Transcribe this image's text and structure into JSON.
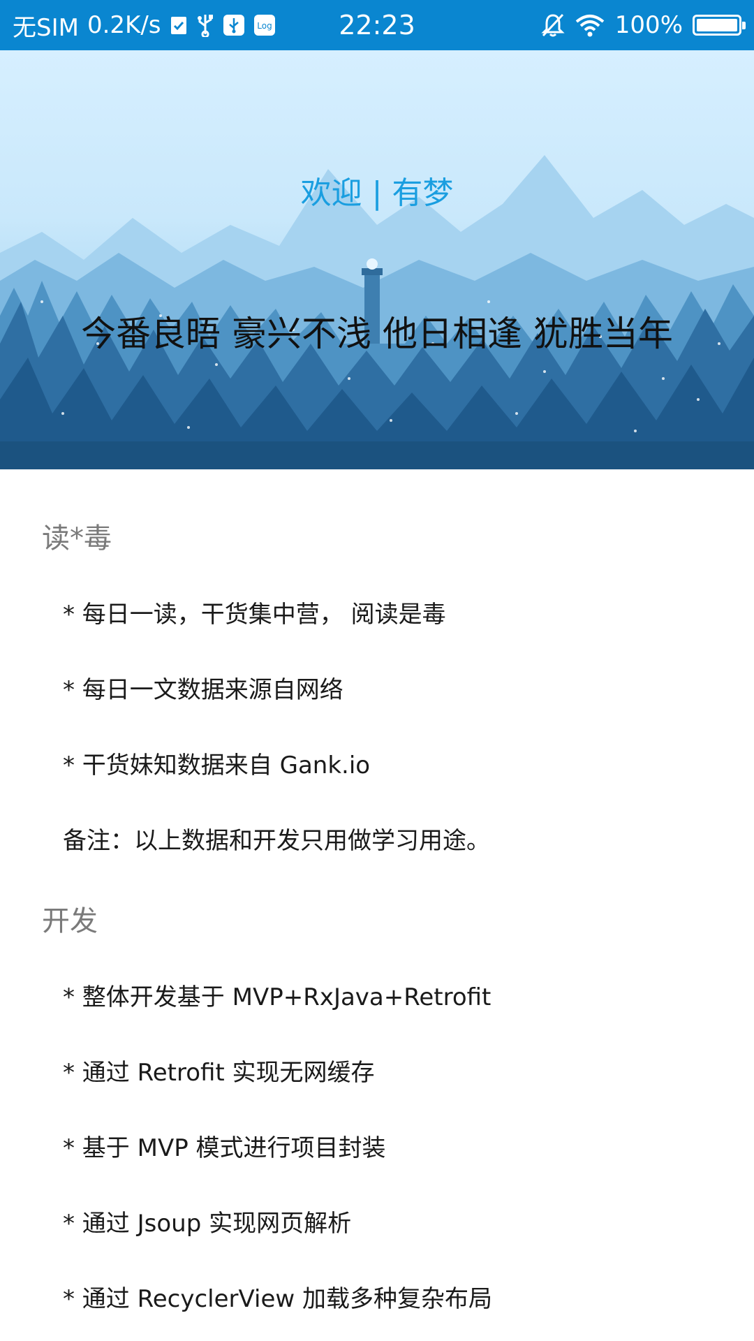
{
  "status_bar": {
    "carrier": "无SIM",
    "speed": "0.2K/s",
    "time": "22:23",
    "battery": "100%",
    "icons_left": [
      "check-clipboard-icon",
      "usb-icon",
      "usb-debug-icon",
      "log-icon"
    ],
    "icons_right": [
      "mute-bell-icon",
      "wifi-icon",
      "battery-icon"
    ],
    "background_color": "#0a86d0"
  },
  "header": {
    "welcome": "欢迎 | 有梦",
    "poem": "今番良晤 豪兴不浅 他日相逢 犹胜当年",
    "welcome_color": "#1a9ee0"
  },
  "sections": [
    {
      "title": "读*毒",
      "items": [
        "* 每日一读，干货集中营， 阅读是毒",
        "* 每日一文数据来源自网络",
        "* 干货妹知数据来自 Gank.io",
        "备注：以上数据和开发只用做学习用途。"
      ]
    },
    {
      "title": "开发",
      "items": [
        "* 整体开发基于 MVP+RxJava+Retrofit",
        "* 通过 Retrofit 实现无网缓存",
        "* 基于 MVP 模式进行项目封装",
        "* 通过 Jsoup 实现网页解析",
        "* 通过 RecyclerView 加载多种复杂布局"
      ]
    }
  ]
}
